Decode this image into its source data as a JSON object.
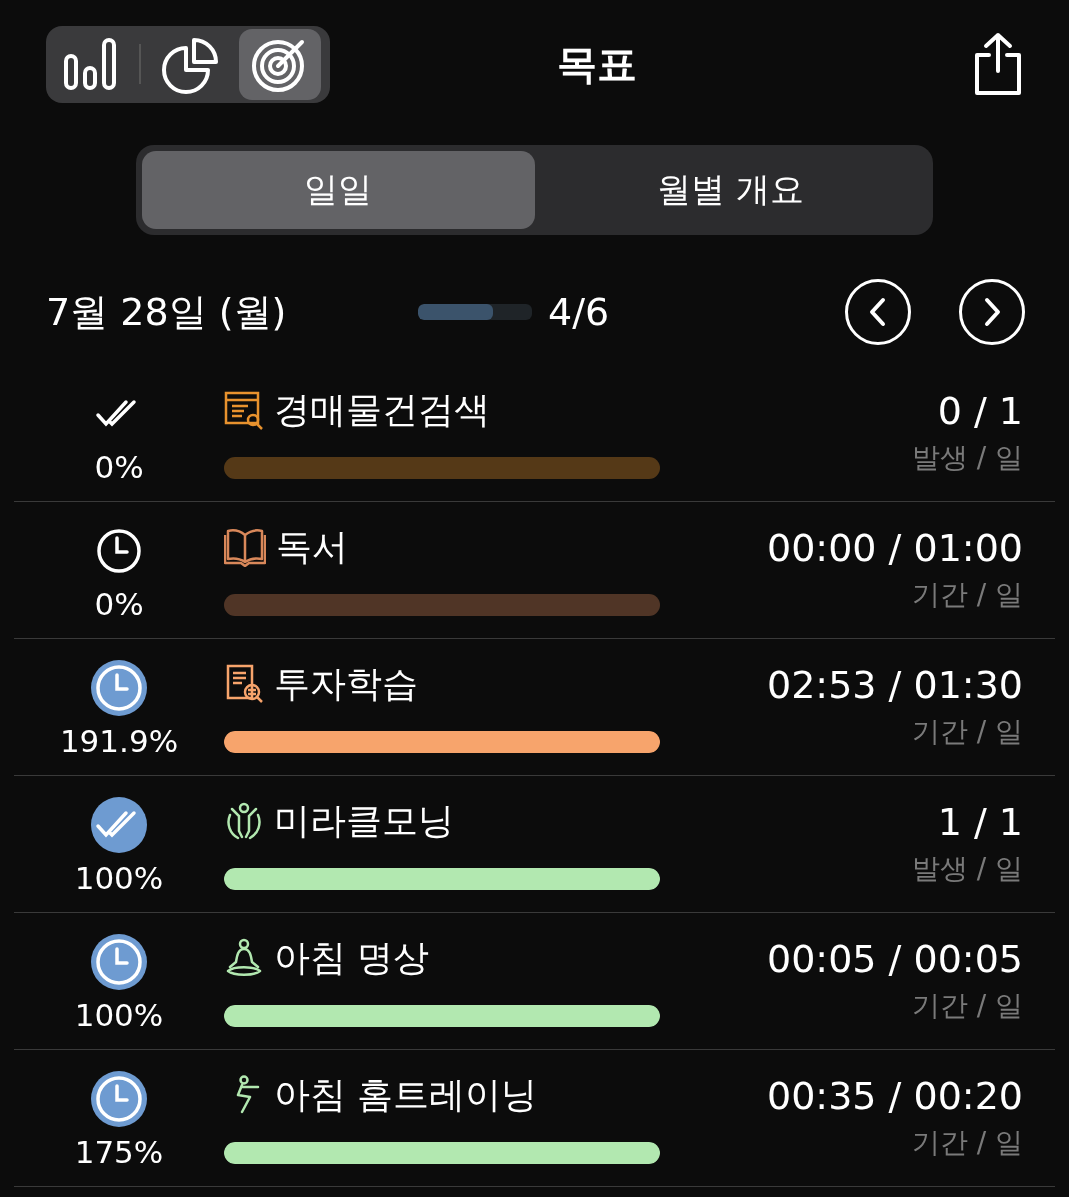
{
  "header": {
    "views": [
      {
        "selected": false
      },
      {
        "selected": false
      },
      {
        "selected": true
      }
    ],
    "title": "목표"
  },
  "tabs": [
    {
      "label": "일일",
      "selected": true
    },
    {
      "label": "월별 개요",
      "selected": false
    }
  ],
  "day": {
    "date": "7월 28일 (월)",
    "level": 0.66,
    "count": "4/6"
  },
  "goals": [
    {
      "kind": "check",
      "done": false,
      "percent": "0%",
      "title": "경매물건검색",
      "color": "#e8922e",
      "level": 0,
      "value": "0 / 1",
      "unit": "발생 / 일"
    },
    {
      "kind": "timer",
      "done": false,
      "percent": "0%",
      "title": "독서",
      "color": "#d9885a",
      "level": 0,
      "value": "00:00 / 01:00",
      "unit": "기간 / 일"
    },
    {
      "kind": "timer",
      "done": true,
      "percent": "191.9%",
      "title": "투자학습",
      "color": "#f7a46c",
      "level": 1,
      "value": "02:53 / 01:30",
      "unit": "기간 / 일"
    },
    {
      "kind": "check",
      "done": true,
      "percent": "100%",
      "title": "미라클모닝",
      "color": "#b2e8b0",
      "level": 1,
      "value": "1 / 1",
      "unit": "발생 / 일"
    },
    {
      "kind": "timer",
      "done": true,
      "percent": "100%",
      "title": "아침 명상",
      "color": "#b2e8b0",
      "level": 1,
      "value": "00:05 / 00:05",
      "unit": "기간 / 일"
    },
    {
      "kind": "timer",
      "done": true,
      "percent": "175%",
      "title": "아침 홈트레이닝",
      "color": "#b2e8b0",
      "level": 1,
      "value": "00:35 / 00:20",
      "unit": "기간 / 일"
    }
  ]
}
